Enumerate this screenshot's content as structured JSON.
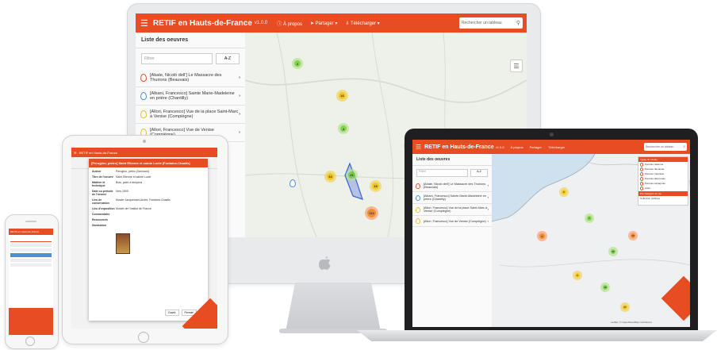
{
  "app": {
    "title": "RETIF en Hauts-de-France",
    "version": "v1.0.0",
    "nav": {
      "about": "À propos",
      "share": "Partager",
      "download": "Télécharger"
    },
    "search_placeholder": "Rechercher un tableau"
  },
  "sidebar": {
    "heading": "Liste des oeuvres",
    "filter_placeholder": "Filtrer",
    "sort_label": "A-Z",
    "items": [
      {
        "label": "[Abate, Nicolò dell'] Le Massacre des Thurions (Beauvais)",
        "color": "#e84c22"
      },
      {
        "label": "[Albani, Francesco] Sainte Marie-Madeleine en prière (Chantilly)",
        "color": "#4a90d9"
      },
      {
        "label": "[Allori, Francesco] Vue de la place Saint-Marc à Venise (Compiègne)",
        "color": "#e0c02a"
      },
      {
        "label": "[Allori, Francesco] Vue de Venise (Compiègne)",
        "color": "#e0c02a"
      }
    ]
  },
  "tablet": {
    "popup_title": "[Perugino, pietro] Saint Etienne et sainte Lucie (Fontaine-Chaalis)",
    "fields": [
      {
        "key": "Auteur",
        "value": "Perugino, pietro (Vannucci)"
      },
      {
        "key": "Titre de l'oeuvre",
        "value": "Saint Etienne et sainte Lucie"
      },
      {
        "key": "Matière et technique",
        "value": "Bois, peint à tempera"
      },
      {
        "key": "Date ou période de l'oeuvre",
        "value": "Vers 1500"
      },
      {
        "key": "Lieu de conservation",
        "value": "Musée Jacquemart-André, Fontaine-Chaalis"
      },
      {
        "key": "Lieu d'exposition",
        "value": "Musée de l'Institut de France"
      },
      {
        "key": "Commentaire",
        "value": ""
      },
      {
        "key": "Ressources",
        "value": ""
      },
      {
        "key": "Illustration",
        "value": ""
      }
    ],
    "btn_open": "Ouvrir",
    "btn_close": "Fermer"
  },
  "phone": {
    "title": "RETIF en Hauts-de-France"
  },
  "laptop": {
    "legend_title": "Types de musée",
    "legend_items": [
      "Peinture italienne",
      "Peinture flamande",
      "Peinture française",
      "Peinture allemande",
      "Peinture espagnole",
      "Autre"
    ],
    "legend_title2": "Par catégorie de clé",
    "legend_item2": "Collection publique",
    "attribution": "Leaflet | © OpenStreetMap contributors"
  },
  "imac_clusters": [
    "2",
    "16",
    "4",
    "34",
    "41",
    "4",
    "19",
    "113",
    "64"
  ],
  "laptop_clusters": [
    "5",
    "7",
    "6",
    "32",
    "9",
    "19",
    "13",
    "27"
  ],
  "colors": {
    "accent": "#e84c22",
    "cluster_green": "#6ecc39",
    "cluster_yellow": "#f0c20c",
    "cluster_orange": "#f18017"
  }
}
